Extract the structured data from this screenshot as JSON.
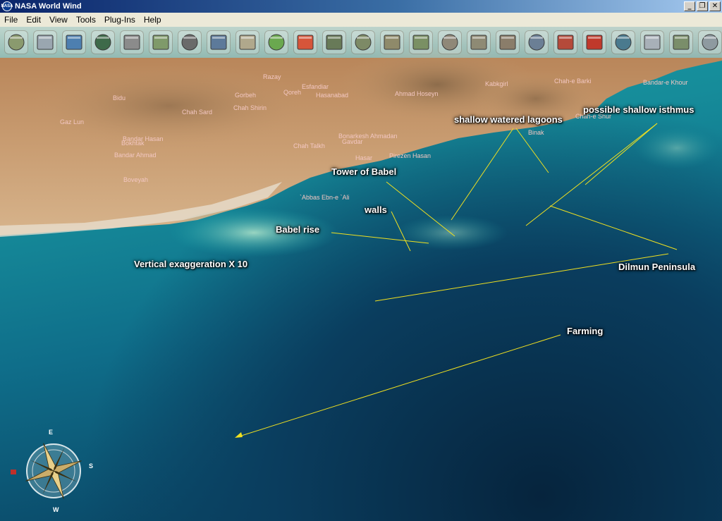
{
  "window": {
    "title": "NASA World Wind",
    "logo_text": "NASA",
    "minimize": "_",
    "maximize": "❐",
    "close": "✕"
  },
  "menu": [
    "File",
    "Edit",
    "View",
    "Tools",
    "Plug-Ins",
    "Help"
  ],
  "toolbar": {
    "tools": [
      {
        "icon": "layer-manager-icon",
        "color": "#8a9a6e"
      },
      {
        "icon": "lat-lon-grid-icon",
        "color": "#9aa6b0"
      },
      {
        "icon": "globe-icon",
        "color": "#4d7fb0"
      },
      {
        "icon": "blue-marble-icon",
        "color": "#3e6a4a"
      },
      {
        "icon": "compass-crosshair-icon",
        "color": "#8b8b8b"
      },
      {
        "icon": "landsat-icon",
        "color": "#7f9a6a"
      },
      {
        "icon": "search-icon",
        "color": "#6a6a6a"
      },
      {
        "icon": "place-names-icon",
        "color": "#5d7a9a"
      },
      {
        "icon": "boundaries-icon",
        "color": "#b0a88c"
      },
      {
        "icon": "wms-browser-icon",
        "color": "#6aa84f"
      },
      {
        "icon": "animated-earth-icon",
        "color": "#d6553a"
      },
      {
        "icon": "usgs-ortho-icon",
        "color": "#687a58"
      },
      {
        "icon": "usgs-topo-icon",
        "color": "#7d8a66"
      },
      {
        "icon": "usgs-urban-icon",
        "color": "#8f8a6a"
      },
      {
        "icon": "usgs-color-icon",
        "color": "#7a9064"
      },
      {
        "icon": "onearth-icon",
        "color": "#8f8878"
      },
      {
        "icon": "usgs-gap-icon",
        "color": "#8e8a74"
      },
      {
        "icon": "usgs-geo-icon",
        "color": "#8a7d6a"
      },
      {
        "icon": "zoomit-icon",
        "color": "#6b7f95"
      },
      {
        "icon": "rapid-fire-modis-icon",
        "color": "#b54a3a"
      },
      {
        "icon": "flags-icon",
        "color": "#c0392b"
      },
      {
        "icon": "landmarks-icon",
        "color": "#4a7a8e"
      },
      {
        "icon": "scale-bar-icon",
        "color": "#a8b0b8"
      },
      {
        "icon": "world-wind-icon",
        "color": "#7a8e6a"
      },
      {
        "icon": "settings-icon",
        "color": "#8e9aa0"
      }
    ]
  },
  "annotations": [
    "shallow watered lagoons",
    "possible shallow isthmus",
    "Tower of Babel",
    "walls",
    "Babel rise",
    "Vertical exaggeration X 10",
    "Dilmun Peninsula",
    "Farming"
  ],
  "place_names": [
    "Razay",
    "Bidu",
    "Esfandiar",
    "Qoreh",
    "Gorbeh",
    "Hasanabad",
    "Ahmad Hoseyn",
    "Kabkgirl",
    "Chah-e Barki",
    "Bandar-e Khour",
    "Gaz Lun",
    "Chah Shirin",
    "Chah Sard",
    "Binak",
    "Bonarkesh Ahmadan",
    "Gavdar",
    "Chah Talkh",
    "Hasar",
    "Pirezen Hasan",
    "Bandar Hasan",
    "Bokhtak",
    "Bandar Ahmad",
    "Boveyah",
    "`Abbas Ebn-e `Ali",
    "Chah-e Shur"
  ],
  "compass": {
    "north": "N",
    "east": "E",
    "south": "S",
    "west": "W"
  }
}
